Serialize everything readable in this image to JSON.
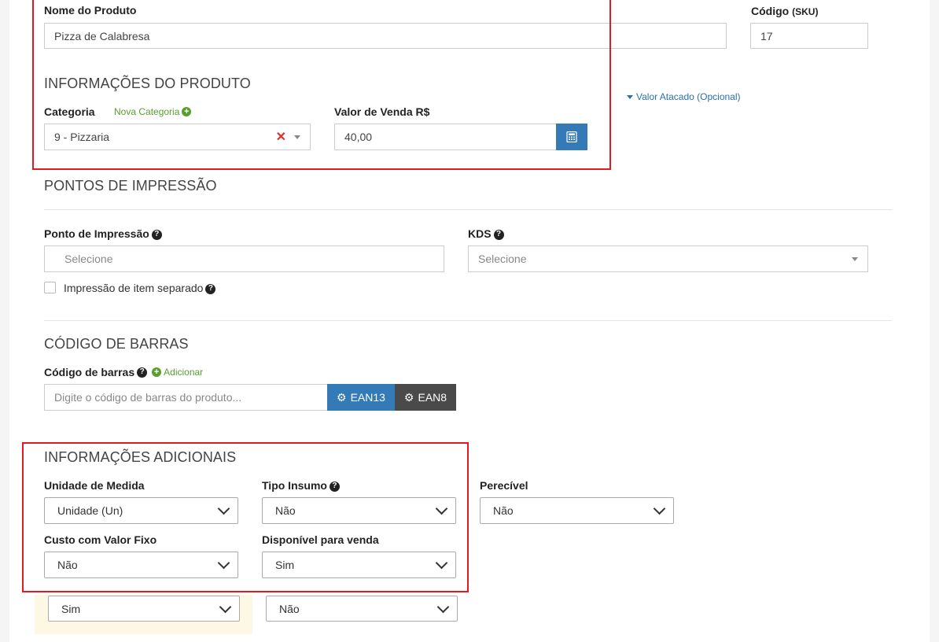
{
  "product": {
    "name_label": "Nome do Produto",
    "name_value": "Pizza de Calabresa",
    "code_label": "Código",
    "code_sub": "(SKU)",
    "code_value": "17"
  },
  "product_info": {
    "section_title": "INFORMAÇÕES DO PRODUTO",
    "category_label": "Categoria",
    "new_category_link": "Nova Categoria",
    "category_value": "9 - Pizzaria",
    "sale_value_label": "Valor de Venda R$",
    "sale_value": "40,00",
    "wholesale_link": "Valor Atacado (Opcional)"
  },
  "print_points": {
    "section_title": "PONTOS DE IMPRESSÃO",
    "print_point_label": "Ponto de Impressão",
    "print_point_placeholder": "Selecione",
    "kds_label": "KDS",
    "kds_placeholder": "Selecione",
    "separate_print_label": "Impressão de item separado"
  },
  "barcode": {
    "section_title": "CÓDIGO DE BARRAS",
    "barcode_label": "Código de barras",
    "add_link": "Adicionar",
    "barcode_placeholder": "Digite o código de barras do produto...",
    "ean13_label": "EAN13",
    "ean8_label": "EAN8"
  },
  "additional": {
    "section_title": "INFORMAÇÕES ADICIONAIS",
    "unit_label": "Unidade de Medida",
    "unit_value": "Unidade (Un)",
    "input_type_label": "Tipo Insumo",
    "input_type_value": "Não",
    "perishable_label": "Perecível",
    "perishable_value": "Não",
    "fixed_cost_label": "Custo com Valor Fixo",
    "fixed_cost_value": "Não",
    "available_label": "Disponível para venda",
    "available_value": "Sim",
    "extra_select_1_value": "Sim",
    "extra_select_2_value": "Não"
  },
  "colors": {
    "highlight_red": "#e01b24",
    "primary_blue": "#337ab7",
    "dark_button": "#4a4a4a",
    "link_green": "#5a9e2e",
    "link_blue": "#2a6fb0"
  }
}
